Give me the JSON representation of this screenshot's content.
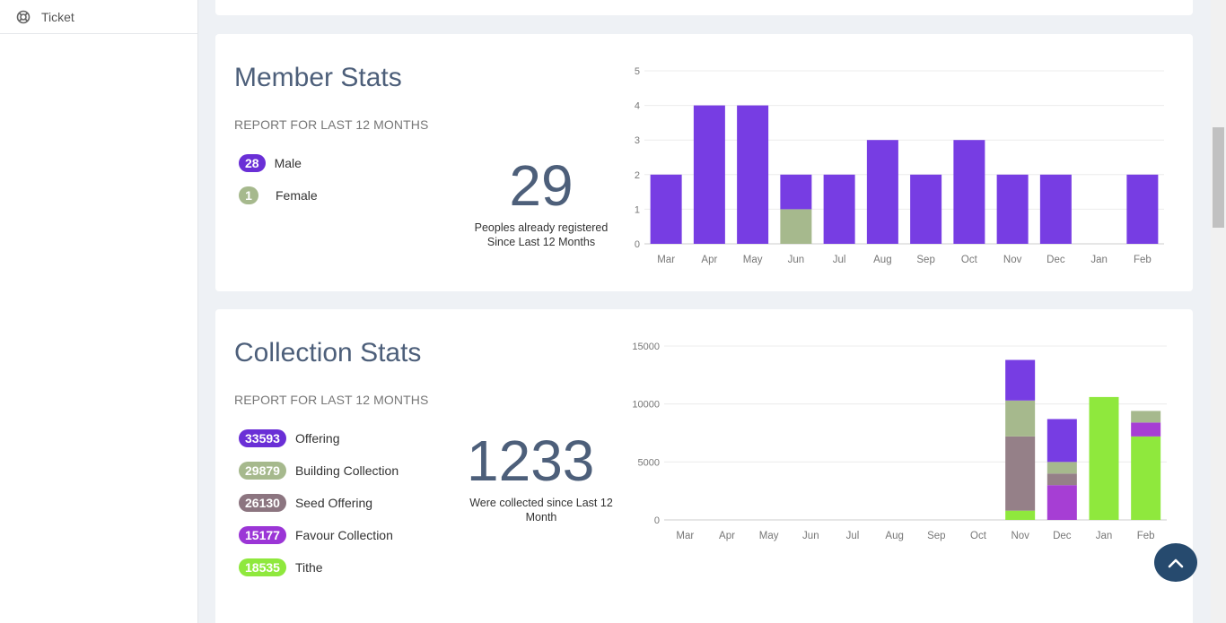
{
  "sidebar": {
    "items": [
      {
        "label": "Ticket",
        "icon": "life-ring-icon"
      }
    ]
  },
  "member_stats": {
    "title": "Member Stats",
    "subtitle": "REPORT FOR LAST 12 MONTHS",
    "legend": [
      {
        "count": "28",
        "label": "Male",
        "color": "#6a2fd6"
      },
      {
        "count": "1",
        "label": "Female",
        "color": "#a6b98d"
      }
    ],
    "total": "29",
    "caption_line1": "Peoples already registered",
    "caption_line2": "Since Last 12 Months"
  },
  "collection_stats": {
    "title": "Collection Stats",
    "subtitle": "REPORT FOR LAST 12 MONTHS",
    "legend": [
      {
        "count": "33593",
        "label": "Offering",
        "color": "#6a2fd6"
      },
      {
        "count": "29879",
        "label": "Building Collection",
        "color": "#a6b98d"
      },
      {
        "count": "26130",
        "label": "Seed Offering",
        "color": "#8c7580"
      },
      {
        "count": "15177",
        "label": "Favour Collection",
        "color": "#9b35d6"
      },
      {
        "count": "18535",
        "label": "Tithe",
        "color": "#8fe83d"
      }
    ],
    "total": "1233",
    "caption_line1": "Were collected since Last 12",
    "caption_line2": "Month"
  },
  "chart_data": [
    {
      "type": "bar",
      "stacked": true,
      "categories": [
        "Mar",
        "Apr",
        "May",
        "Jun",
        "Jul",
        "Aug",
        "Sep",
        "Oct",
        "Nov",
        "Dec",
        "Jan",
        "Feb"
      ],
      "series": [
        {
          "name": "Female",
          "color": "#a6b98d",
          "values": [
            0,
            0,
            0,
            1,
            0,
            0,
            0,
            0,
            0,
            0,
            0,
            0
          ]
        },
        {
          "name": "Male",
          "color": "#773de3",
          "values": [
            2,
            4,
            4,
            1,
            2,
            3,
            2,
            3,
            2,
            2,
            0,
            2
          ]
        }
      ],
      "ylim": [
        0,
        5
      ],
      "yticks": [
        0,
        1,
        2,
        3,
        4,
        5
      ],
      "grid": true
    },
    {
      "type": "bar",
      "stacked": true,
      "categories": [
        "Mar",
        "Apr",
        "May",
        "Jun",
        "Jul",
        "Aug",
        "Sep",
        "Oct",
        "Nov",
        "Dec",
        "Jan",
        "Feb"
      ],
      "series": [
        {
          "name": "Tithe",
          "color": "#8fe83d",
          "values": [
            0,
            0,
            0,
            0,
            0,
            0,
            0,
            0,
            800,
            0,
            10600,
            7200
          ]
        },
        {
          "name": "Favour Collection",
          "color": "#a63ed4",
          "values": [
            0,
            0,
            0,
            0,
            0,
            0,
            0,
            0,
            0,
            3000,
            0,
            1200
          ]
        },
        {
          "name": "Seed Offering",
          "color": "#958088",
          "values": [
            0,
            0,
            0,
            0,
            0,
            0,
            0,
            0,
            6400,
            1000,
            0,
            0
          ]
        },
        {
          "name": "Building Collection",
          "color": "#a6b98d",
          "values": [
            0,
            0,
            0,
            0,
            0,
            0,
            0,
            0,
            3100,
            1000,
            0,
            1000
          ]
        },
        {
          "name": "Offering",
          "color": "#773de3",
          "values": [
            0,
            0,
            0,
            0,
            0,
            0,
            0,
            0,
            3500,
            3700,
            0,
            0
          ]
        }
      ],
      "ylim": [
        0,
        15000
      ],
      "yticks": [
        0,
        5000,
        10000,
        15000
      ],
      "grid": true
    }
  ]
}
